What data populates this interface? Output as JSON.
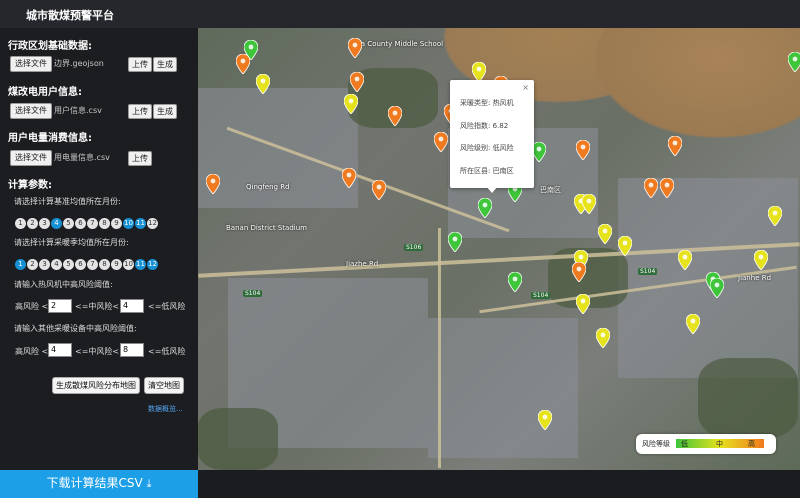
{
  "app": {
    "title": "城市散煤预警平台"
  },
  "sidebar": {
    "section1": {
      "title": "行政区划基础数据:",
      "choose": "选择文件",
      "file": "边界.geojson",
      "upload": "上传",
      "generate": "生成"
    },
    "section2": {
      "title": "煤改电用户信息:",
      "choose": "选择文件",
      "file": "用户信息.csv",
      "upload": "上传",
      "generate": "生成"
    },
    "section3": {
      "title": "用户电量消费信息:",
      "choose": "选择文件",
      "file": "用电量信息.csv",
      "upload": "上传"
    },
    "calc": {
      "title": "计算参数:",
      "base_label": "请选择计算基准均值所在月份:",
      "base_months": [
        "1",
        "2",
        "3",
        "4",
        "5",
        "6",
        "7",
        "8",
        "9",
        "10",
        "11",
        "12"
      ],
      "heat_label": "请选择计算采暖季均值所在月份:",
      "heat_months": [
        "1",
        "2",
        "3",
        "4",
        "5",
        "6",
        "7",
        "8",
        "9",
        "10",
        "11",
        "12"
      ],
      "hp_label": "请输入热风机中高风险阈值:",
      "hp_high": "高风险 <",
      "hp_v1": "2",
      "hp_mid": "<=中风险<",
      "hp_v2": "4",
      "hp_low": "<=低风险",
      "other_label": "请输入其他采暖设备中高风险阈值:",
      "ot_high": "高风险 <",
      "ot_v1": "4",
      "ot_mid": "<=中风险<",
      "ot_v2": "8",
      "ot_low": "<=低风险"
    },
    "actions": {
      "generate_map": "生成散煤风险分布地图",
      "clear_map": "清空地图",
      "link": "数据概览..."
    },
    "download": {
      "label": "下载计算结果CSV"
    }
  },
  "map": {
    "labels": {
      "school": "Ba County Middle School",
      "road1": "Qingfeng Rd",
      "stadium": "Banan District Stadium",
      "road2": "Jiazhe Rd",
      "road3": "Jianhe Rd",
      "s104": "S104",
      "s106": "S106",
      "s104b": "S104",
      "s104c": "S104",
      "bnq": "巴南区"
    },
    "popup": {
      "type": "采暖类型: 热风机",
      "index": "风险指数: 6.82",
      "level": "风险级别: 低风险",
      "district": "所在区县: 巴南区",
      "close": "×"
    },
    "legend": {
      "title": "风险等级",
      "low": "低",
      "mid": "中",
      "high": "高"
    },
    "colors": {
      "low": "#3fc53a",
      "mid": "#e6e21c",
      "high": "#f07a1f"
    }
  }
}
